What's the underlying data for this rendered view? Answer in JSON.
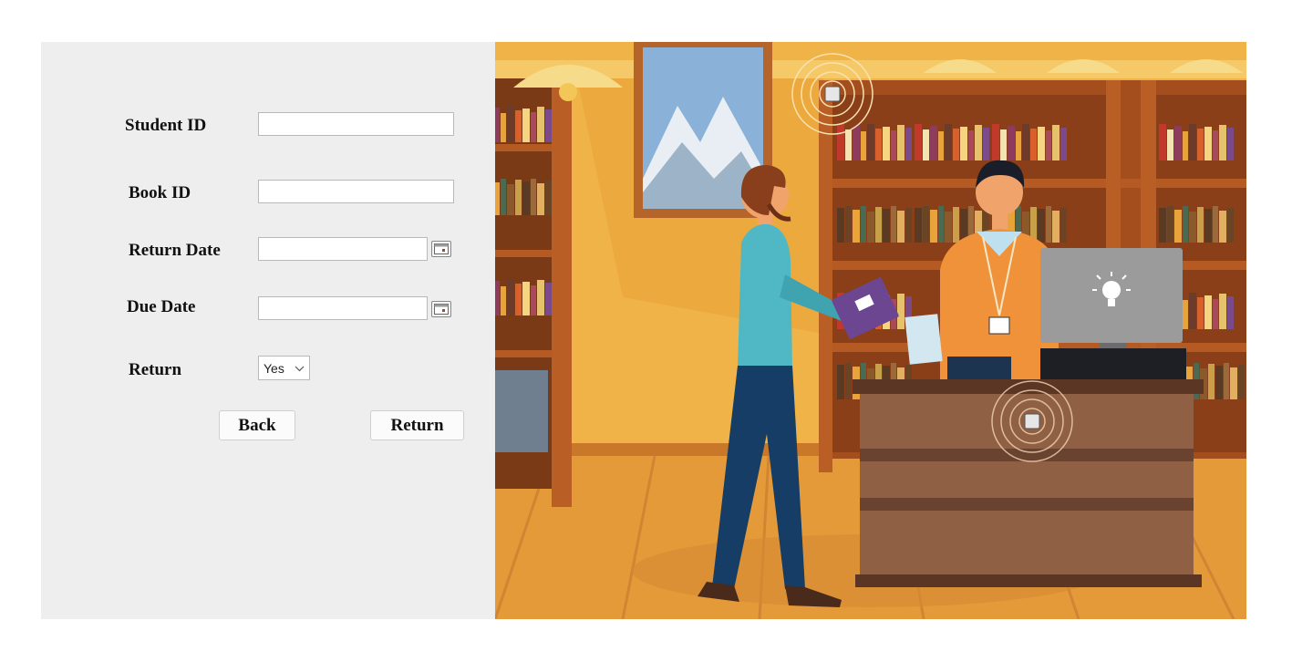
{
  "form": {
    "student_id": {
      "label": "Student ID",
      "value": ""
    },
    "book_id": {
      "label": "Book ID",
      "value": ""
    },
    "return_date": {
      "label": "Return Date",
      "value": "",
      "icon": "calendar-icon"
    },
    "due_date": {
      "label": "Due Date",
      "value": "",
      "icon": "calendar-icon"
    },
    "return": {
      "label": "Return",
      "selected": "Yes",
      "icon": "chevron-down-icon"
    }
  },
  "buttons": {
    "back": "Back",
    "return": "Return"
  },
  "illustration": {
    "subject": "library-checkout-counter",
    "colors": {
      "wall": "#f0b347",
      "floor": "#e59a3a",
      "shelf": "#b55a22",
      "desk": "#8a5a3c"
    }
  }
}
